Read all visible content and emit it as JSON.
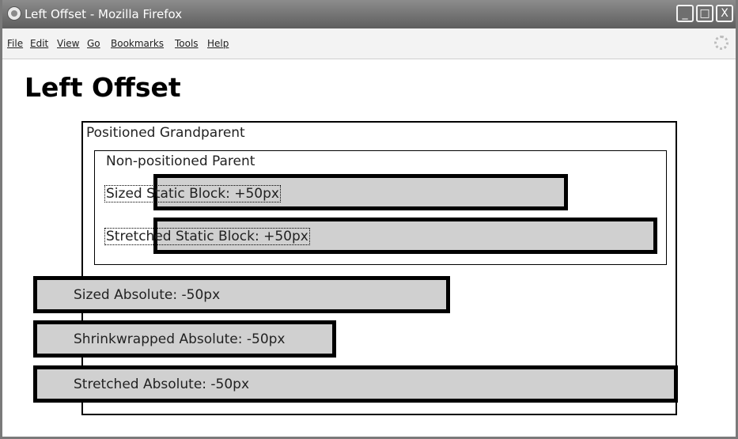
{
  "window": {
    "title": "Left Offset - Mozilla Firefox",
    "controls": {
      "minimize": "_",
      "maximize": "□",
      "close": "X"
    }
  },
  "menu": [
    "File",
    "Edit",
    "View",
    "Go",
    "Bookmarks",
    "Tools",
    "Help"
  ],
  "page": {
    "heading": "Left Offset",
    "grandparent_label": "Positioned Grandparent",
    "parent_label": "Non-positioned Parent",
    "sized_static": "Sized Static Block: +50px",
    "stretched_static": "Stretched Static Block: +50px",
    "sized_absolute": "Sized Absolute: -50px",
    "shrinkwrapped_absolute": "Shrinkwrapped Absolute: -50px",
    "stretched_absolute": "Stretched Absolute: -50px"
  },
  "colors": {
    "block_fill": "#d0d0d0",
    "block_border": "#000000",
    "titlebar": "#6e6e6e"
  }
}
